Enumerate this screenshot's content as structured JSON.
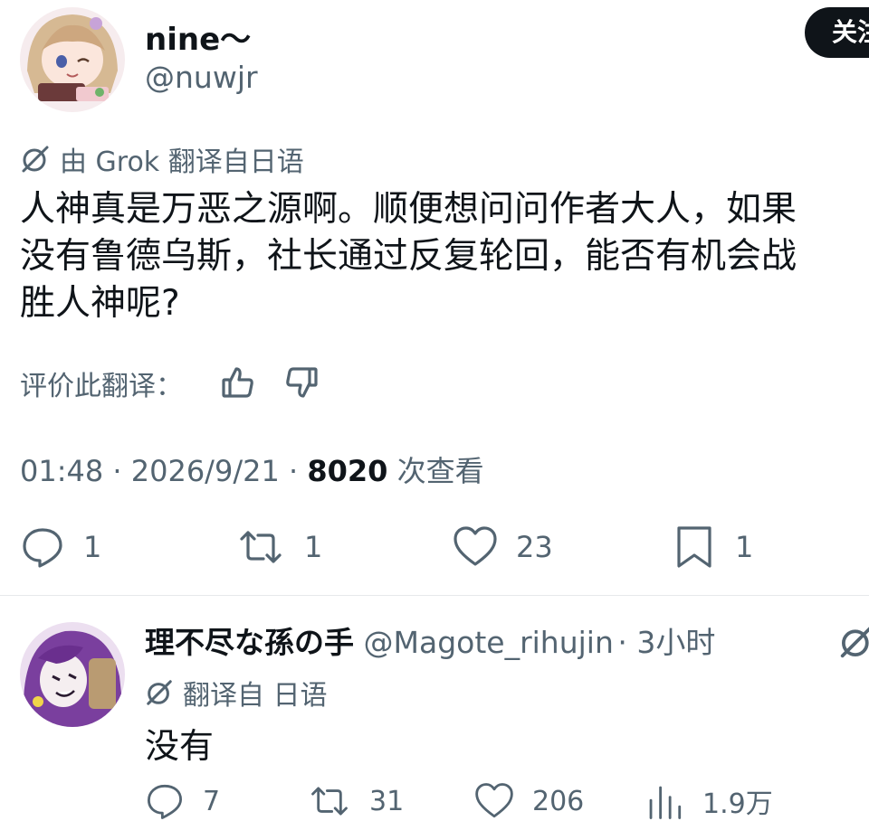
{
  "tweet": {
    "author": {
      "name": "nine～",
      "handle": "@nuwjr"
    },
    "follow_label": "关注",
    "translation": {
      "label": "由 Grok 翻译自日语"
    },
    "text_lines": [
      "人神真是万恶之源啊。顺便想问问作者大人，如果",
      "没有鲁德乌斯，社长通过反复轮回，能否有机会战",
      "胜人神呢?"
    ],
    "rate_label": "评价此翻译：",
    "meta": {
      "time": "01:48",
      "sep": "·",
      "date": "2026/9/21",
      "views": "8020",
      "views_label": "次查看"
    },
    "stats": {
      "replies": "1",
      "retweets": "1",
      "likes": "23",
      "bookmarks": "1"
    }
  },
  "reply": {
    "author": {
      "name": "理不尽な孫の手",
      "handle": "@Magote_rihujin",
      "time": "· 3小时"
    },
    "translation": {
      "label": "翻译自 日语"
    },
    "text": "没有",
    "stats": {
      "replies": "7",
      "retweets": "31",
      "likes": "206",
      "views": "1.9万"
    }
  }
}
